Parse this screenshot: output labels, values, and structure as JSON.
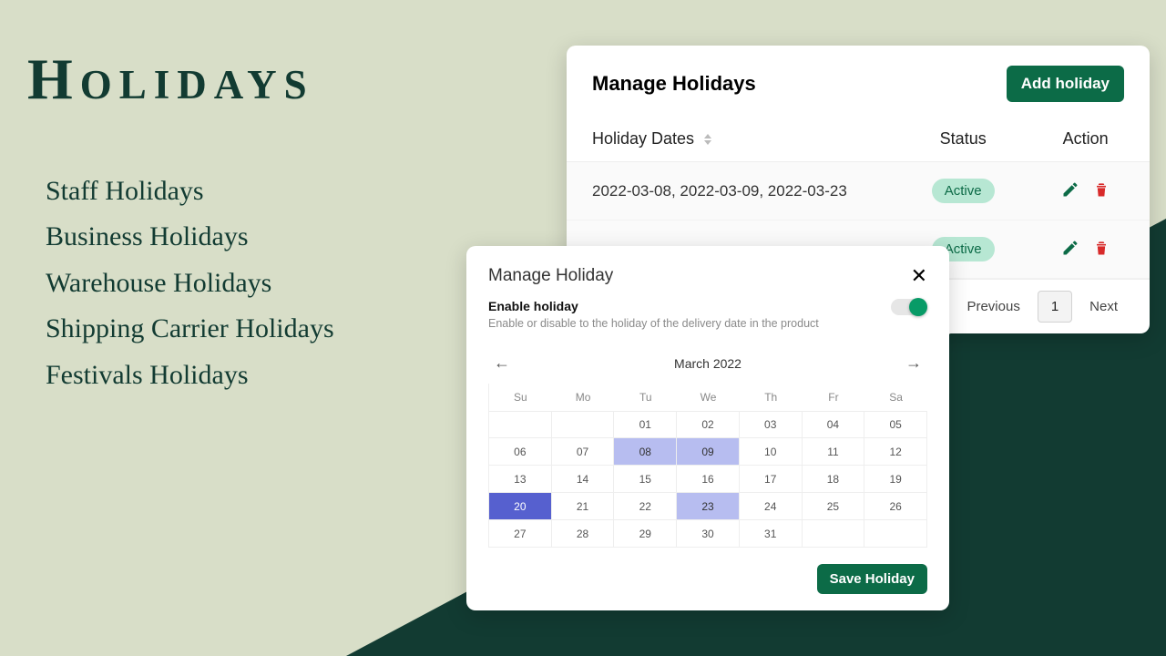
{
  "hero": {
    "title": "Holidays",
    "features": [
      "Staff Holidays",
      "Business Holidays",
      "Warehouse Holidays",
      "Shipping Carrier Holidays",
      "Festivals Holidays"
    ]
  },
  "manage": {
    "title": "Manage Holidays",
    "add_btn": "Add holiday",
    "col_dates": "Holiday Dates",
    "col_status": "Status",
    "col_action": "Action",
    "rows": [
      {
        "dates": "2022-03-08, 2022-03-09, 2022-03-23",
        "status": "Active"
      },
      {
        "dates": "",
        "status": "Active"
      }
    ],
    "pager": {
      "prev": "Previous",
      "page": "1",
      "next": "Next"
    }
  },
  "modal": {
    "title": "Manage Holiday",
    "enable_label": "Enable holiday",
    "enable_desc": "Enable or disable to the holiday of the delivery date in the product",
    "month_label": "March 2022",
    "dow": [
      "Su",
      "Mo",
      "Tu",
      "We",
      "Th",
      "Fr",
      "Sa"
    ],
    "days": [
      [
        "",
        "",
        "01",
        "02",
        "03",
        "04",
        "05"
      ],
      [
        "06",
        "07",
        "08",
        "09",
        "10",
        "11",
        "12"
      ],
      [
        "13",
        "14",
        "15",
        "16",
        "17",
        "18",
        "19"
      ],
      [
        "20",
        "21",
        "22",
        "23",
        "24",
        "25",
        "26"
      ],
      [
        "27",
        "28",
        "29",
        "30",
        "31",
        "",
        ""
      ]
    ],
    "selected_light": [
      "08",
      "09",
      "23"
    ],
    "selected_dark": [
      "20"
    ],
    "save_btn": "Save Holiday"
  },
  "colors": {
    "brand": "#0c6b47",
    "danger": "#d82a2a"
  }
}
